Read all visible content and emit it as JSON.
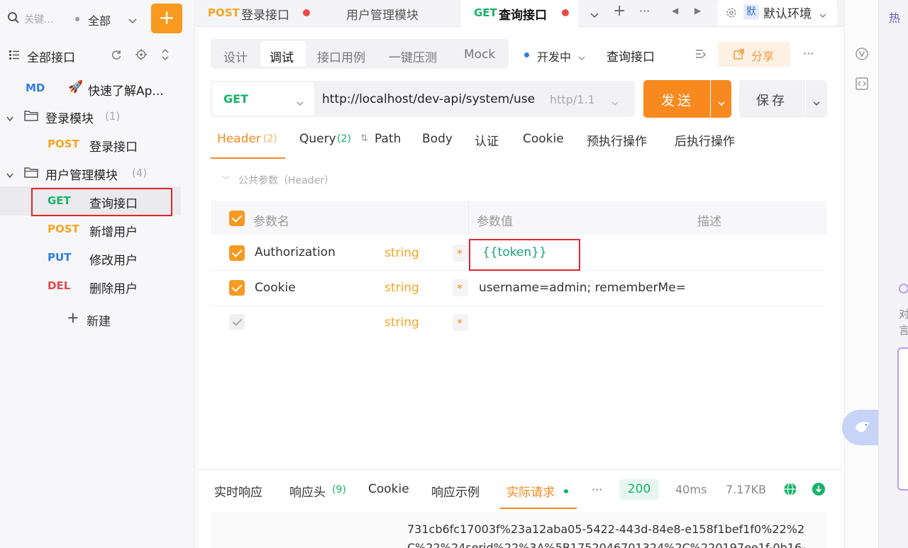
{
  "sidebar": {
    "search_placeholder": "关键...",
    "filter_label": "全部",
    "add_button": "+",
    "all_apis_label": "全部接口",
    "md_tag": "MD",
    "md_label": "快速了解Ap...",
    "folders": [
      {
        "name": "登录模块",
        "count": "(1)"
      },
      {
        "name": "用户管理模块",
        "count": "(4)"
      }
    ],
    "items": [
      {
        "method": "POST",
        "name": "登录接口"
      },
      {
        "method": "GET",
        "name": "查询接口"
      },
      {
        "method": "POST",
        "name": "新增用户"
      },
      {
        "method": "PUT",
        "name": "修改用户"
      },
      {
        "method": "DEL",
        "name": "删除用户"
      }
    ],
    "new_label": "新建"
  },
  "tabs": [
    {
      "method": "POST",
      "name": "登录接口"
    },
    {
      "method": "",
      "name": "用户管理模块"
    },
    {
      "method": "GET",
      "name": "查询接口"
    }
  ],
  "env": {
    "badge": "默",
    "name": "默认环境"
  },
  "subtabs": [
    "设计",
    "调试",
    "接口用例",
    "一键压测",
    "Mock"
  ],
  "status_label": "开发中",
  "api_name": "查询接口",
  "share_label": "分享",
  "more": "···",
  "request": {
    "method": "GET",
    "url": "http://localhost/dev-api/system/use",
    "protocol": "http/1.1",
    "send_label": "发送",
    "save_label": "保存"
  },
  "param_tabs": {
    "header": "Header",
    "header_count": "(2)",
    "query": "Query",
    "query_count": "(2)",
    "path": "Path",
    "body": "Body",
    "auth": "认证",
    "cookie": "Cookie",
    "pre": "预执行操作",
    "post": "后执行操作"
  },
  "public_params": "公共参数（Header）",
  "table": {
    "col_name": "参数名",
    "col_value": "参数值",
    "col_desc": "描述",
    "rows": [
      {
        "name": "Authorization",
        "type": "string",
        "required": "*",
        "value": "{{token}}"
      },
      {
        "name": "Cookie",
        "type": "string",
        "required": "*",
        "value": "username=admin; rememberMe="
      },
      {
        "name": "",
        "type": "string",
        "required": "*",
        "value": ""
      }
    ]
  },
  "response": {
    "tabs": [
      "实时响应",
      "响应头",
      "Cookie",
      "响应示例",
      "实际请求"
    ],
    "header_count": "(9)",
    "status": "200",
    "time": "40ms",
    "size": "7.17KB",
    "body_line1": "731cb6fc17003f%23a12aba05-5422-443d-84e8-e158f1bef1f0%22%2",
    "body_line2": "C%22%24serid%22%3A%5B1752046701324%2C%220197ee1f-0b16-"
  },
  "right_hint": "热",
  "right_text1": "对",
  "right_text2": "言",
  "colors": {
    "accent": "#f79a1f",
    "get": "#17b26a",
    "post": "#f5a623",
    "put": "#2f7de1",
    "del": "#e5484d",
    "highlight": "#e0262d"
  }
}
